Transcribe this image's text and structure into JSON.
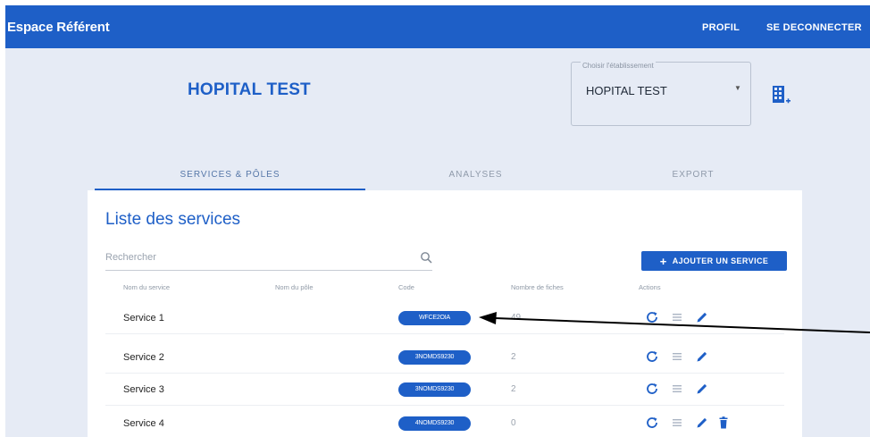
{
  "header": {
    "title": "Espace Référent",
    "nav": {
      "profile": "PROFIL",
      "logout": "SE DECONNECTER"
    }
  },
  "establishment": {
    "name": "HOPITAL TEST",
    "select_label": "Choisir l'établissement",
    "select_value": "HOPITAL TEST"
  },
  "tabs": [
    {
      "label": "SERVICES & PÔLES",
      "active": true
    },
    {
      "label": "ANALYSES",
      "active": false
    },
    {
      "label": "EXPORT",
      "active": false
    }
  ],
  "services_panel": {
    "title": "Liste des services",
    "search_placeholder": "Rechercher",
    "add_button": "AJOUTER UN SERVICE",
    "columns": [
      "Nom du service",
      "Nom du pôle",
      "Code",
      "Nombre de fiches",
      "Actions"
    ],
    "rows": [
      {
        "name": "Service 1",
        "pole": "",
        "code": "WFCE2OIA",
        "count": "49",
        "actions": [
          "refresh-icon",
          "list-icon",
          "edit-icon"
        ]
      },
      {
        "name": "Service 2",
        "pole": "",
        "code": "3NOMDS9230",
        "count": "2",
        "actions": [
          "refresh-icon",
          "list-icon",
          "edit-icon"
        ]
      },
      {
        "name": "Service 3",
        "pole": "",
        "code": "3NOMDS9230",
        "count": "2",
        "actions": [
          "refresh-icon",
          "list-icon",
          "edit-icon"
        ]
      },
      {
        "name": "Service 4",
        "pole": "",
        "code": "4NOMDS9230",
        "count": "0",
        "actions": [
          "refresh-icon",
          "list-icon",
          "edit-icon",
          "delete-icon"
        ]
      }
    ]
  },
  "colors": {
    "primary": "#1e5fc7",
    "background": "#e6ebf5",
    "card": "#ffffff"
  }
}
